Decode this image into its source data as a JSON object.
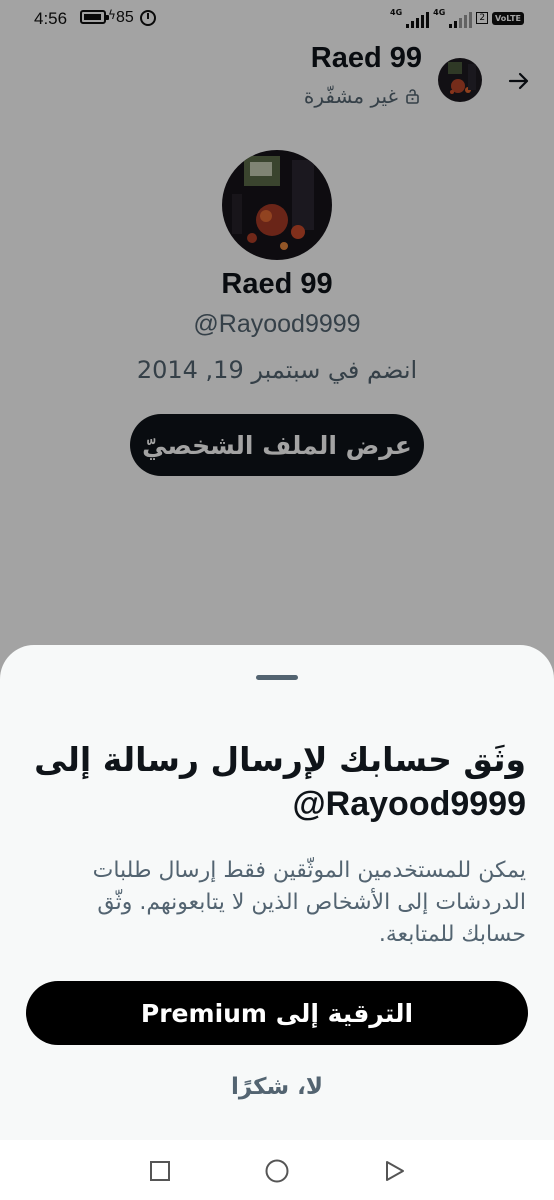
{
  "status_bar": {
    "time": "4:56",
    "battery": "85",
    "network_1": "4G",
    "network_2": "4G",
    "sim": "2",
    "volte": "VoLTE"
  },
  "header": {
    "name": "Raed 99",
    "encryption_label": "غير مشفّرة",
    "back_icon": "arrow-right-icon",
    "lock_icon": "unlock-icon"
  },
  "profile": {
    "name": "Raed 99",
    "handle": "@Rayood9999",
    "joined": "انضم في سبتمبر 19, 2014",
    "view_profile_label": "عرض الملف الشخصيّ"
  },
  "sheet": {
    "title": "وثَق حسابك لإرسال رسالة إلى",
    "handle": "@Rayood9999",
    "body": "يمكن للمستخدمين الموثّقين فقط إرسال طلبات الدردشات إلى الأشخاص الذين لا يتابعونهم. وثّق حسابك للمتابعة.",
    "upgrade_label": "الترقية إلى Premium",
    "no_thanks_label": "لا، شكرًا"
  },
  "nav": {
    "recents_icon": "square-icon",
    "home_icon": "circle-icon",
    "back_icon": "triangle-icon"
  },
  "colors": {
    "primary_text": "#0f1419",
    "secondary_text": "#536471",
    "button_bg": "#000000",
    "sheet_bg": "#f7f9f9"
  }
}
